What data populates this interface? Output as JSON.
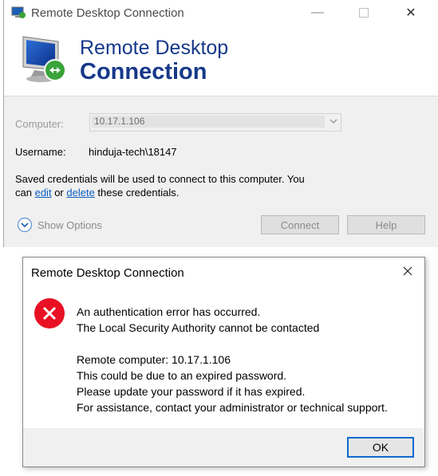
{
  "window": {
    "title": "Remote Desktop Connection",
    "banner_line1": "Remote Desktop",
    "banner_line2": "Connection"
  },
  "form": {
    "computer_label": "Computer:",
    "computer_value": "10.17.1.106",
    "username_label": "Username:",
    "username_value": "hinduja-tech\\18147",
    "creds_line1": "Saved credentials will be used to connect to this computer. You",
    "creds_can": "can",
    "creds_edit": "edit",
    "creds_or": "or",
    "creds_delete": "delete",
    "creds_rest": "these credentials.",
    "show_options": "Show Options",
    "connect": "Connect",
    "help": "Help"
  },
  "dialog": {
    "title": "Remote Desktop Connection",
    "line1": "An authentication error has occurred.",
    "line2": "The Local Security Authority cannot be contacted",
    "line3": "Remote computer: 10.17.1.106",
    "line4": "This could be due to an expired password.",
    "line5": "Please update your password if it has expired.",
    "line6": "For assistance, contact your administrator or technical support.",
    "ok": "OK"
  },
  "colors": {
    "banner_text": "#17398a",
    "link": "#0b5cc0",
    "error_red": "#e81123",
    "ok_border": "#0f6bcf"
  },
  "icons": [
    "rdp-app-icon",
    "rdp-monitor-icon",
    "minimize-icon",
    "maximize-icon",
    "close-icon",
    "chevron-down-icon",
    "show-options-chevron-icon",
    "error-icon"
  ]
}
